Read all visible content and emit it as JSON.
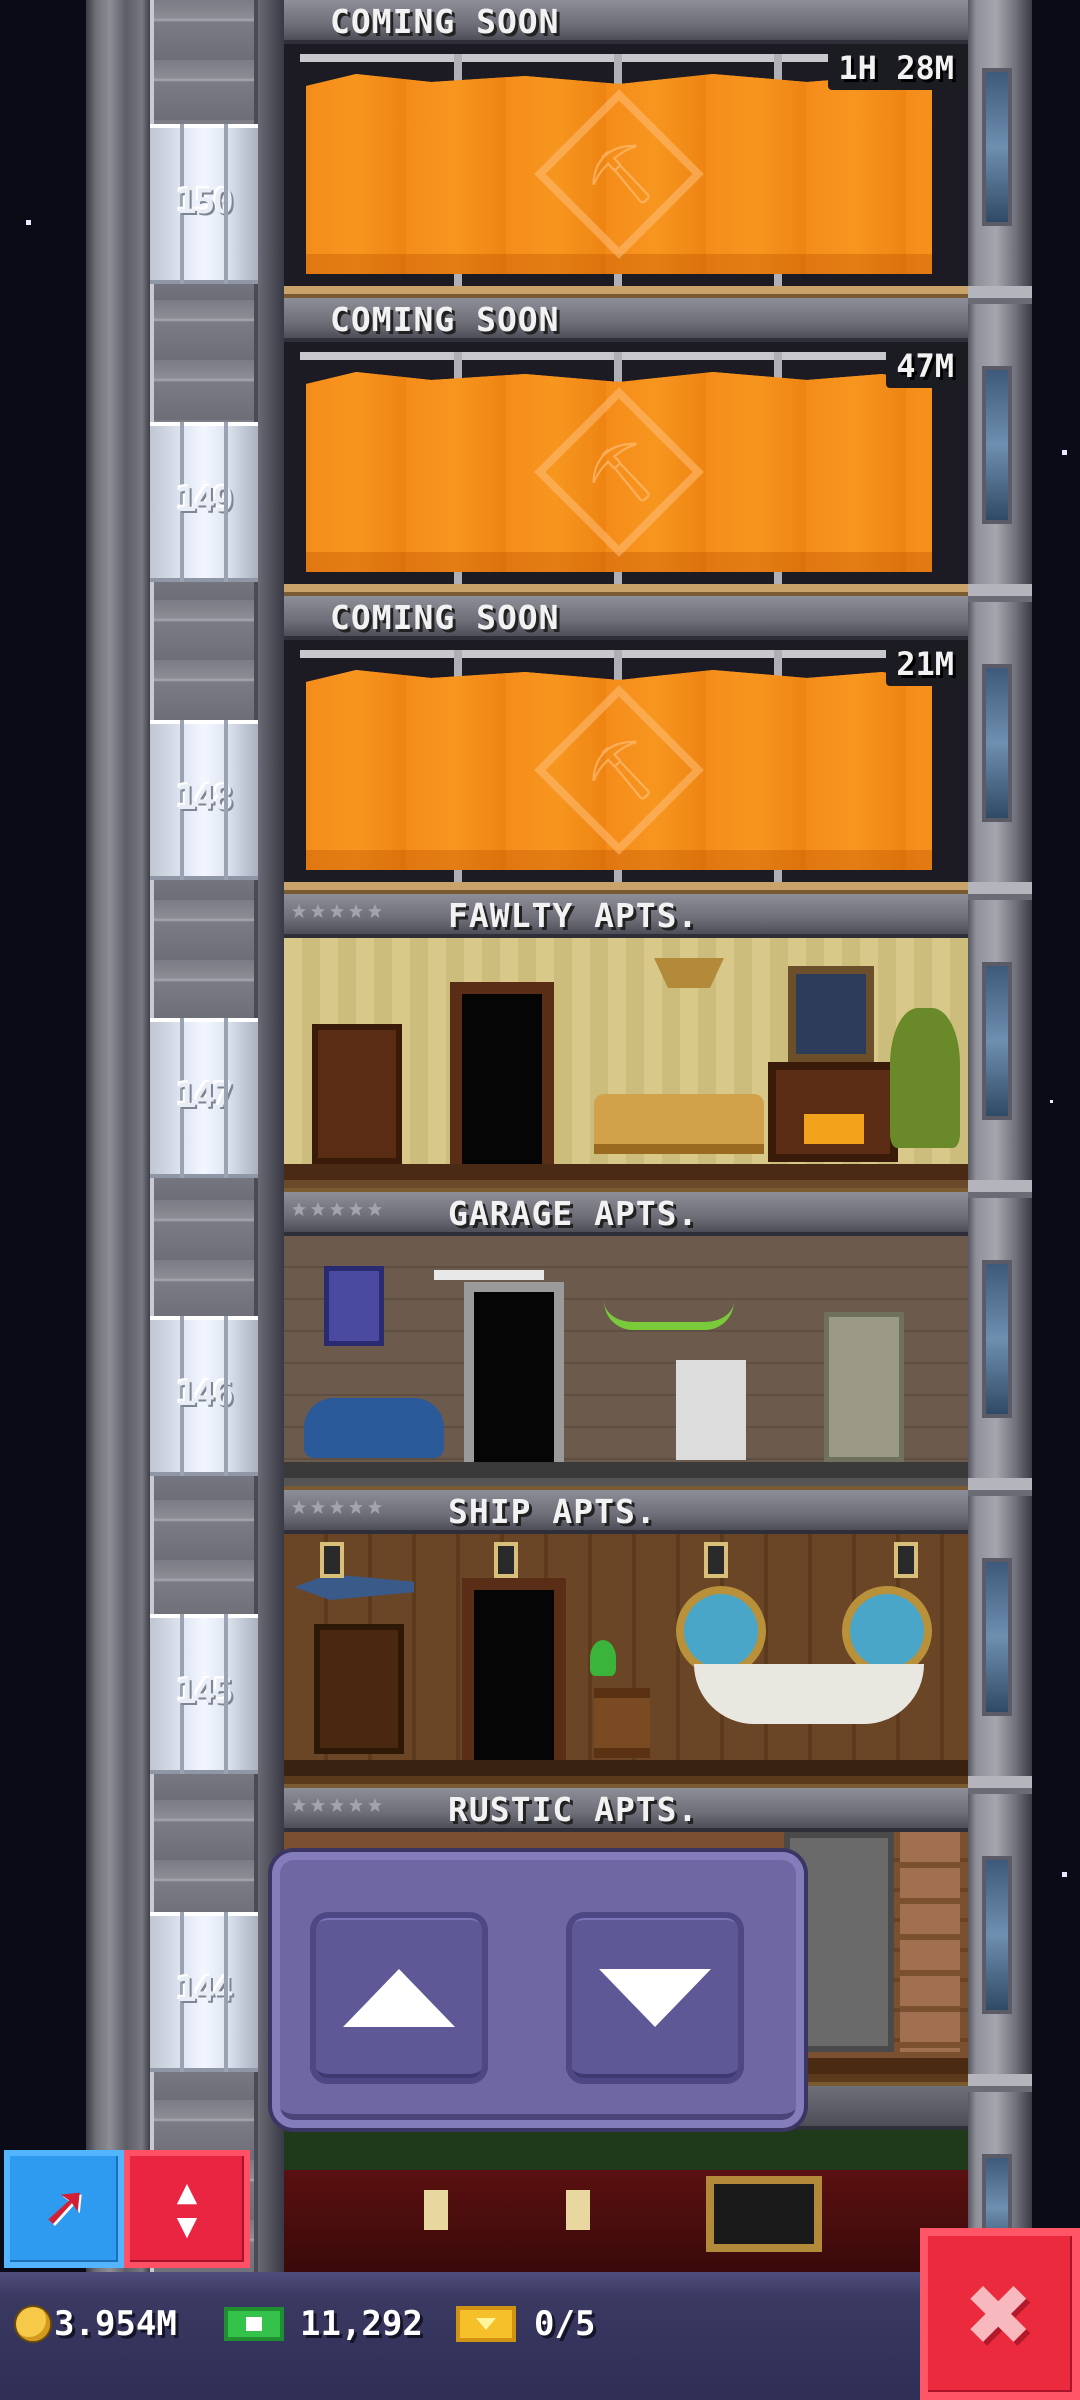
{
  "floors": [
    {
      "number": "150",
      "title": "COMING SOON",
      "timer": "1H 28M",
      "state": "construction"
    },
    {
      "number": "149",
      "title": "COMING SOON",
      "timer": "47M",
      "state": "construction"
    },
    {
      "number": "148",
      "title": "COMING SOON",
      "timer": "21M",
      "state": "construction"
    },
    {
      "number": "147",
      "title": "FAWLTY APTS.",
      "state": "residential"
    },
    {
      "number": "146",
      "title": "GARAGE APTS.",
      "state": "residential"
    },
    {
      "number": "145",
      "title": "SHIP APTS.",
      "state": "residential"
    },
    {
      "number": "144",
      "title": "RUSTIC APTS.",
      "state": "residential"
    }
  ],
  "elevator_controls": {
    "up_icon": "arrow-up-icon",
    "down_icon": "arrow-down-icon"
  },
  "tools": {
    "move_icon": "pointer-arrow-icon",
    "elevator_icon": "elevator-updown-icon"
  },
  "status": {
    "coins": "3.954M",
    "bux": "11,292",
    "tickets": "0/5"
  },
  "close_icon": "close-x-icon",
  "colors": {
    "tarp": "#f58c1a",
    "panel": "#6e67a4",
    "close": "#ec2a3d",
    "tool_blue": "#2e9bf0",
    "tool_red": "#ea2542"
  }
}
